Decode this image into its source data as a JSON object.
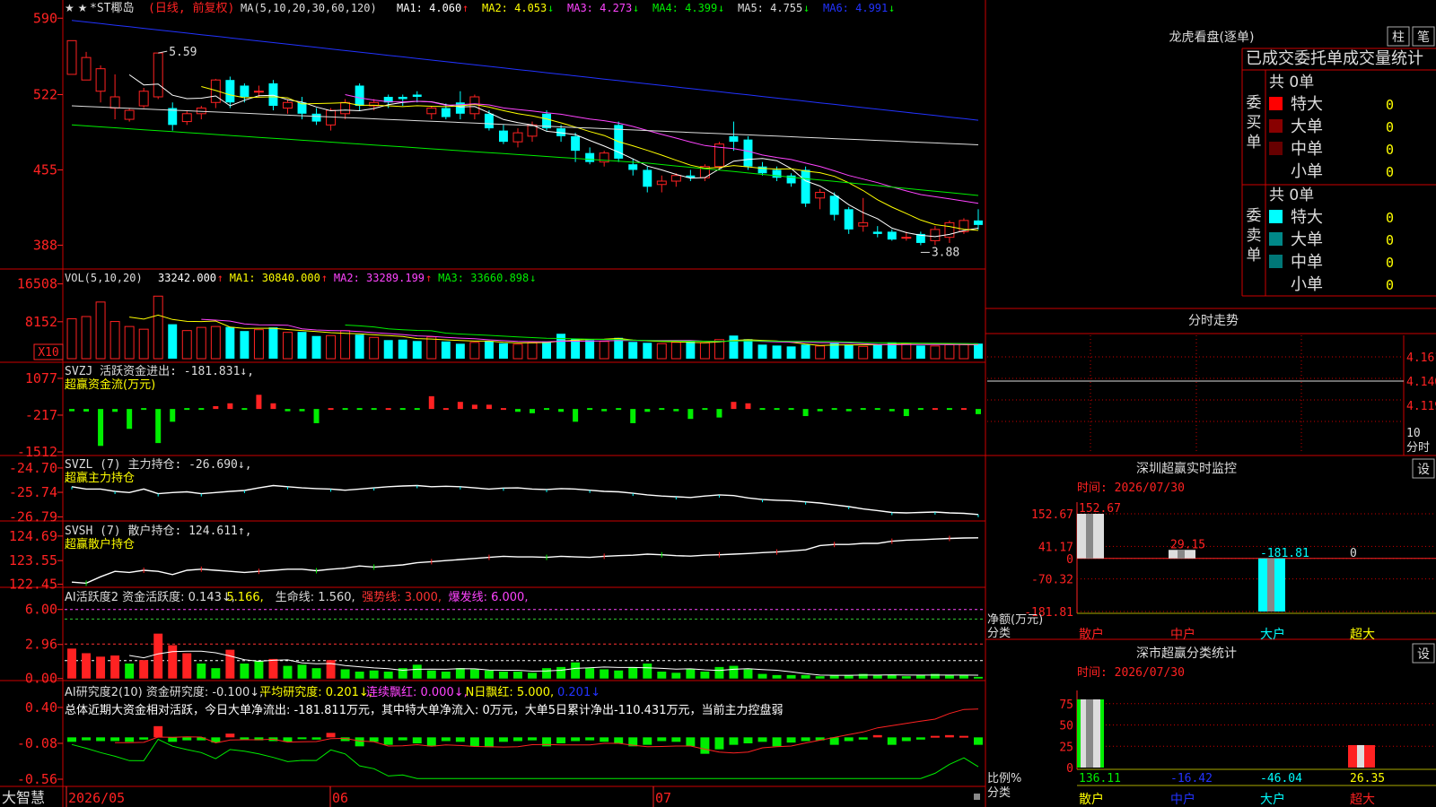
{
  "main_header": {
    "stars": "★ ★",
    "title": "*ST椰岛",
    "mode": "(日线, 前复权)",
    "ma_spec": "MA(5,10,20,30,60,120)",
    "ma_items": [
      {
        "label": "MA1: 4.060",
        "arrow": "↑",
        "color": "#ffffff"
      },
      {
        "label": "MA2: 4.053",
        "arrow": "↓",
        "color": "#ffff00"
      },
      {
        "label": "MA3: 4.273",
        "arrow": "↓",
        "color": "#ff44ff"
      },
      {
        "label": "MA4: 4.399",
        "arrow": "↓",
        "color": "#00ee00"
      },
      {
        "label": "MA5: 4.755",
        "arrow": "↓",
        "color": "#dddddd"
      },
      {
        "label": "MA6: 4.991",
        "arrow": "↓",
        "color": "#2233ff"
      }
    ]
  },
  "price_axis": [
    "590",
    "522",
    "455",
    "388"
  ],
  "price_annotations": {
    "high": "5.59",
    "low": "3.88"
  },
  "vol_header": {
    "spec": "VOL(5,10,20)",
    "items": [
      {
        "label": "33242.000",
        "arrow": "↑",
        "color": "#ffffff"
      },
      {
        "label": "MA1: 30840.000",
        "arrow": "↑",
        "color": "#ffff00"
      },
      {
        "label": "MA2: 33289.199",
        "arrow": "↑",
        "color": "#ff44ff"
      },
      {
        "label": "MA3: 33660.898",
        "arrow": "↓",
        "color": "#00ee00"
      }
    ]
  },
  "vol_axis": [
    "16508",
    "8152"
  ],
  "vol_multiplier": "X10",
  "svzj": {
    "line1": "SVZJ  活跃资金进出: -181.831↓,",
    "line2": "超赢资金流(万元)",
    "axis": [
      "1077",
      "-217",
      "-1512"
    ]
  },
  "svzl": {
    "line1": "SVZL  (7) 主力持仓: -26.690↓,",
    "line2": "超赢主力持仓",
    "axis": [
      "-24.70",
      "-25.74",
      "-26.79"
    ]
  },
  "svsh": {
    "line1": "SVSH  (7) 散户持仓: 124.611↑,",
    "line2": "超赢散户持仓",
    "axis": [
      "124.69",
      "123.55",
      "122.45"
    ]
  },
  "ai1": {
    "items": [
      {
        "label": "AI活跃度2 资金活跃度: 0.143↓,",
        "color": "#dddddd"
      },
      {
        "label": "5.166,",
        "color": "#ffff00"
      },
      {
        "label": "生命线: 1.560,",
        "color": "#dddddd"
      },
      {
        "label": "强势线: 3.000,",
        "color": "#ff3333"
      },
      {
        "label": "爆发线: 6.000,",
        "color": "#ff44ff"
      }
    ],
    "axis": [
      "6.00",
      "2.96",
      "0.00"
    ]
  },
  "ai2": {
    "items": [
      {
        "label": "AI研究度2(10) 资金研究度: -0.100↓,",
        "color": "#dddddd"
      },
      {
        "label": "平均研究度: 0.201↓,",
        "color": "#ffff00"
      },
      {
        "label": "连续飘红: 0.000↓,",
        "color": "#ff44ff"
      },
      {
        "label": "N日飘红: 5.000,",
        "color": "#ffff00"
      },
      {
        "label": "0.201↓",
        "color": "#2233ff"
      }
    ],
    "summary": "总体近期大资金相对活跃，今日大单净流出: -181.811万元，其中特大单净流入: 0万元，大单5日累计净出-110.431万元，当前主力控盘弱",
    "axis": [
      "0.40",
      "-0.08",
      "-0.56"
    ]
  },
  "bottom_axis": {
    "brand": "大智慧",
    "dates": [
      "2026/05",
      "06",
      "07"
    ]
  },
  "panel_lhb": {
    "title": "龙虎看盘(逐单)",
    "btn1": "柱",
    "btn2": "笔",
    "subtitle": "已成交委托单成交量统计",
    "buy": {
      "side": "委买单",
      "count": "共 0单",
      "rows": [
        {
          "name": "特大",
          "value": "0",
          "color": "#ff0000"
        },
        {
          "name": "大单",
          "value": "0",
          "color": "#880000"
        },
        {
          "name": "中单",
          "value": "0",
          "color": "#660000"
        },
        {
          "name": "小单",
          "value": "0",
          "color": ""
        }
      ]
    },
    "sell": {
      "side": "委卖单",
      "count": "共 0单",
      "rows": [
        {
          "name": "特大",
          "value": "0",
          "color": "#00ffff"
        },
        {
          "name": "大单",
          "value": "0",
          "color": "#008888"
        },
        {
          "name": "中单",
          "value": "0",
          "color": "#007777"
        },
        {
          "name": "小单",
          "value": "0",
          "color": ""
        }
      ]
    }
  },
  "panel_fs": {
    "title": "分时走势",
    "axis": [
      "4.161",
      "4.140",
      "4.119"
    ],
    "foot1": "10",
    "foot2": "分时"
  },
  "panel_sz": {
    "title": "深圳超赢实时监控",
    "btn": "设",
    "time": "时间: 2026/07/30",
    "axis": [
      "152.67",
      "41.17",
      "0",
      "-70.32",
      "-181.81"
    ],
    "ylabel": "净额(万元)",
    "xlabel": "分类"
  },
  "panel_fl": {
    "title": "深市超赢分类统计",
    "btn": "设",
    "time": "时间: 2026/07/30",
    "axis": [
      "75",
      "50",
      "25",
      "0"
    ],
    "ylabel": "比例%",
    "xlabel": "分类"
  },
  "chart_data": [
    {
      "type": "candlestick",
      "title": "*ST椰岛 (日线, 前复权)",
      "ylim": [
        3.7,
        5.95
      ],
      "candles": [
        [
          5.4,
          5.7,
          5.5,
          5.7
        ],
        [
          5.35,
          5.55,
          5.5,
          5.6
        ],
        [
          5.25,
          5.45,
          5.15,
          5.48
        ],
        [
          5.1,
          5.2,
          5.0,
          5.4
        ],
        [
          5.0,
          5.08,
          4.98,
          5.1
        ],
        [
          5.12,
          5.25,
          5.1,
          5.28
        ],
        [
          5.2,
          5.59,
          5.18,
          5.59
        ],
        [
          5.1,
          4.95,
          4.9,
          5.15
        ],
        [
          4.98,
          5.05,
          4.95,
          5.08
        ],
        [
          5.05,
          5.1,
          5.0,
          5.12
        ],
        [
          5.15,
          5.35,
          5.1,
          5.36
        ],
        [
          5.35,
          5.15,
          5.1,
          5.38
        ],
        [
          5.3,
          5.2,
          5.15,
          5.32
        ],
        [
          5.25,
          5.25,
          5.2,
          5.3
        ],
        [
          5.32,
          5.12,
          5.08,
          5.35
        ],
        [
          5.1,
          5.15,
          5.05,
          5.18
        ],
        [
          5.15,
          5.05,
          5.0,
          5.2
        ],
        [
          5.05,
          4.98,
          4.95,
          5.1
        ],
        [
          4.95,
          5.08,
          4.9,
          5.1
        ],
        [
          5.05,
          5.15,
          5.0,
          5.18
        ],
        [
          5.3,
          5.12,
          5.08,
          5.32
        ],
        [
          5.12,
          5.15,
          5.08,
          5.18
        ],
        [
          5.2,
          5.15,
          5.1,
          5.22
        ],
        [
          5.2,
          5.18,
          5.12,
          5.22
        ],
        [
          5.22,
          5.2,
          5.15,
          5.25
        ],
        [
          5.05,
          5.1,
          5.0,
          5.12
        ],
        [
          5.1,
          5.02,
          5.0,
          5.14
        ],
        [
          5.15,
          5.05,
          5.0,
          5.25
        ],
        [
          5.05,
          5.2,
          5.0,
          5.22
        ],
        [
          5.05,
          4.92,
          4.9,
          5.08
        ],
        [
          4.9,
          4.8,
          4.78,
          4.95
        ],
        [
          4.8,
          4.88,
          4.75,
          4.92
        ],
        [
          4.85,
          4.95,
          4.8,
          4.98
        ],
        [
          5.05,
          4.92,
          4.9,
          5.08
        ],
        [
          4.92,
          4.85,
          4.8,
          4.95
        ],
        [
          4.85,
          4.72,
          4.62,
          4.88
        ],
        [
          4.7,
          4.62,
          4.6,
          4.75
        ],
        [
          4.62,
          4.7,
          4.58,
          4.72
        ],
        [
          4.95,
          4.65,
          4.62,
          4.98
        ],
        [
          4.6,
          4.55,
          4.5,
          4.65
        ],
        [
          4.55,
          4.4,
          4.35,
          4.58
        ],
        [
          4.42,
          4.45,
          4.35,
          4.5
        ],
        [
          4.45,
          4.5,
          4.4,
          4.52
        ],
        [
          4.5,
          4.48,
          4.45,
          4.55
        ],
        [
          4.48,
          4.58,
          4.45,
          4.6
        ],
        [
          4.58,
          4.78,
          4.55,
          4.8
        ],
        [
          4.85,
          4.8,
          4.72,
          4.98
        ],
        [
          4.82,
          4.58,
          4.55,
          4.85
        ],
        [
          4.58,
          4.52,
          4.5,
          4.62
        ],
        [
          4.55,
          4.48,
          4.45,
          4.58
        ],
        [
          4.5,
          4.43,
          4.4,
          4.52
        ],
        [
          4.55,
          4.25,
          4.22,
          4.58
        ],
        [
          4.3,
          4.35,
          4.2,
          4.38
        ],
        [
          4.32,
          4.15,
          4.1,
          4.35
        ],
        [
          4.2,
          4.02,
          3.98,
          4.22
        ],
        [
          4.05,
          4.08,
          4.0,
          4.3
        ],
        [
          4.0,
          3.98,
          3.95,
          4.05
        ],
        [
          4.0,
          3.93,
          3.92,
          4.02
        ],
        [
          3.95,
          3.95,
          3.92,
          4.0
        ],
        [
          3.98,
          3.9,
          3.88,
          4.0
        ],
        [
          3.92,
          4.02,
          3.88,
          4.05
        ],
        [
          3.95,
          4.08,
          3.9,
          4.1
        ],
        [
          4.0,
          4.1,
          3.98,
          4.12
        ],
        [
          4.1,
          4.06,
          4.02,
          4.2
        ]
      ]
    },
    {
      "type": "bar",
      "title": "VOL(5,10,20)",
      "ylim": [
        0,
        19000
      ],
      "values": [
        8800,
        9300,
        12500,
        8200,
        7100,
        6500,
        13800,
        7600,
        6200,
        6900,
        7100,
        7000,
        6100,
        6400,
        6900,
        5800,
        5900,
        5000,
        5100,
        6200,
        5300,
        4700,
        4100,
        4200,
        3900,
        4800,
        3800,
        3300,
        3600,
        3900,
        3400,
        3200,
        3500,
        3800,
        5500,
        4400,
        4100,
        3800,
        4600,
        3700,
        3500,
        3300,
        3600,
        3800,
        3500,
        4200,
        5100,
        4300,
        3100,
        2900,
        2700,
        3100,
        2800,
        3500,
        3100,
        2700,
        3200,
        3600,
        3400,
        2900,
        2800,
        3100,
        3200,
        3320
      ]
    },
    {
      "type": "bar",
      "title": "超赢资金流(万元)",
      "ylim": [
        -1512,
        1077
      ],
      "values": [
        -80,
        -90,
        -1300,
        -100,
        -700,
        -50,
        -1200,
        -450,
        -20,
        -10,
        100,
        200,
        -30,
        500,
        200,
        -80,
        -80,
        -500,
        40,
        -30,
        -20,
        -50,
        0,
        -20,
        -30,
        450,
        0,
        250,
        150,
        150,
        50,
        -100,
        -150,
        -60,
        -100,
        -450,
        -40,
        -80,
        -30,
        -500,
        -100,
        -30,
        -80,
        -350,
        -60,
        -300,
        250,
        200,
        -50,
        -40,
        -20,
        -250,
        -80,
        -50,
        -80,
        -30,
        -60,
        -80,
        -250,
        -50,
        40,
        -60,
        40,
        -181.8
      ]
    },
    {
      "type": "line",
      "title": "超赢主力持仓",
      "ylim": [
        -26.85,
        -24.55
      ],
      "values": [
        -25.5,
        -25.6,
        -25.6,
        -25.7,
        -25.75,
        -25.6,
        -25.8,
        -25.75,
        -25.72,
        -25.8,
        -25.75,
        -25.7,
        -25.66,
        -25.55,
        -25.45,
        -25.5,
        -25.55,
        -25.58,
        -25.6,
        -25.65,
        -25.6,
        -25.55,
        -25.5,
        -25.47,
        -25.45,
        -25.5,
        -25.48,
        -25.5,
        -25.55,
        -25.6,
        -25.56,
        -25.55,
        -25.6,
        -25.62,
        -25.58,
        -25.6,
        -25.65,
        -25.7,
        -25.72,
        -25.78,
        -25.85,
        -25.9,
        -25.93,
        -25.96,
        -25.9,
        -25.85,
        -25.88,
        -25.98,
        -26.05,
        -26.08,
        -26.1,
        -26.15,
        -26.2,
        -26.28,
        -26.35,
        -26.45,
        -26.52,
        -26.6,
        -26.62,
        -26.6,
        -26.58,
        -26.62,
        -26.64,
        -26.69
      ]
    },
    {
      "type": "line",
      "title": "超赢散户持仓",
      "ylim": [
        122.35,
        124.85
      ],
      "values": [
        122.55,
        122.5,
        122.8,
        123.05,
        123.0,
        123.1,
        123.05,
        122.9,
        123.1,
        123.15,
        123.1,
        123.05,
        123.0,
        123.05,
        123.1,
        123.15,
        123.15,
        123.08,
        123.15,
        123.2,
        123.3,
        123.25,
        123.3,
        123.35,
        123.45,
        123.5,
        123.55,
        123.6,
        123.65,
        123.7,
        123.75,
        123.72,
        123.72,
        123.7,
        123.75,
        123.72,
        123.7,
        123.75,
        123.78,
        123.8,
        123.85,
        123.82,
        123.78,
        123.76,
        123.8,
        123.82,
        123.85,
        123.88,
        123.92,
        123.95,
        124.0,
        124.05,
        124.25,
        124.3,
        124.3,
        124.35,
        124.35,
        124.45,
        124.5,
        124.52,
        124.55,
        124.58,
        124.6,
        124.61
      ]
    },
    {
      "type": "bar",
      "title": "AI活跃度2",
      "ylim": [
        -0.1,
        6.6
      ],
      "values": [
        2.6,
        2.2,
        1.9,
        2.0,
        1.3,
        1.6,
        3.9,
        2.9,
        2.2,
        1.3,
        0.9,
        2.5,
        1.3,
        1.5,
        1.7,
        1.1,
        1.2,
        0.9,
        1.6,
        0.8,
        0.6,
        0.7,
        0.6,
        0.9,
        1.2,
        0.7,
        0.6,
        0.9,
        0.8,
        0.7,
        0.6,
        0.6,
        0.5,
        0.9,
        1.0,
        1.4,
        0.9,
        0.8,
        0.7,
        1.0,
        1.3,
        0.6,
        0.5,
        0.8,
        0.6,
        1.0,
        1.1,
        0.8,
        0.4,
        0.3,
        0.3,
        0.3,
        0.2,
        0.3,
        0.3,
        0.4,
        0.3,
        0.3,
        0.2,
        0.3,
        0.4,
        0.3,
        0.3,
        0.143
      ],
      "reference_lines": [
        6.0,
        5.166,
        3.0,
        1.56
      ]
    },
    {
      "type": "bar",
      "title": "AI研究度2(10)",
      "ylim": [
        -0.62,
        0.46
      ],
      "values": [
        -0.06,
        -0.04,
        -0.05,
        -0.05,
        -0.06,
        -0.03,
        0.15,
        -0.06,
        -0.04,
        -0.04,
        -0.07,
        0.05,
        -0.03,
        -0.04,
        -0.05,
        -0.06,
        -0.02,
        -0.03,
        0.06,
        -0.05,
        -0.12,
        -0.06,
        -0.1,
        -0.04,
        -0.08,
        -0.12,
        -0.05,
        -0.06,
        -0.12,
        -0.13,
        -0.06,
        -0.05,
        -0.04,
        -0.12,
        -0.08,
        -0.05,
        -0.04,
        -0.06,
        -0.08,
        -0.12,
        -0.1,
        -0.05,
        -0.06,
        -0.12,
        -0.22,
        -0.16,
        -0.1,
        -0.08,
        -0.06,
        -0.12,
        -0.07,
        -0.05,
        -0.04,
        -0.1,
        -0.05,
        -0.03,
        0.03,
        -0.1,
        -0.05,
        -0.03,
        0.02,
        0.03,
        0.02,
        -0.1
      ]
    },
    {
      "type": "bar",
      "title": "深圳超赢实时监控",
      "categories": [
        "散户",
        "中户",
        "大户",
        "超大"
      ],
      "values": [
        152.67,
        29.15,
        -181.81,
        0
      ],
      "ylim": [
        -181.81,
        152.67
      ]
    },
    {
      "type": "bar",
      "title": "深市超赢分类统计",
      "categories": [
        "散户",
        "中户",
        "大户",
        "超大"
      ],
      "values": [
        136.11,
        -16.42,
        -46.04,
        26.35
      ],
      "ylim": [
        0,
        80
      ]
    }
  ]
}
